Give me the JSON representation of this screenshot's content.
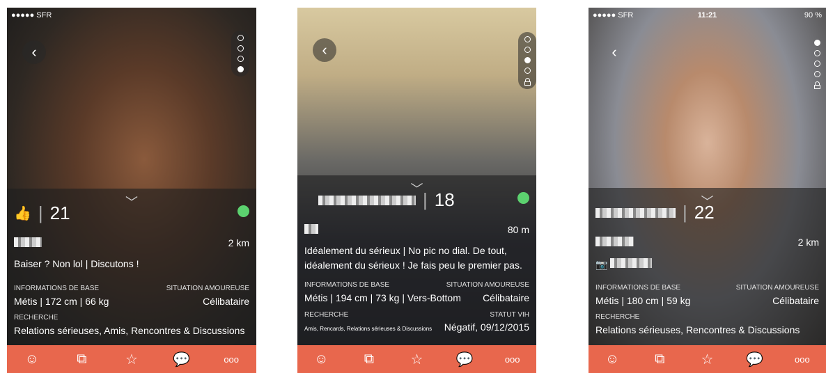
{
  "phone1": {
    "status": {
      "carrier": "●●●●● SFR"
    },
    "age": "21",
    "distance": "2 km",
    "about": "Baiser ? Non lol | Discutons !",
    "base_label": "INFORMATIONS DE BASE",
    "status_label": "SITUATION AMOUREUSE",
    "base_value": "Métis | 172 cm | 66 kg",
    "status_value": "Célibataire",
    "search_label": "RECHERCHE",
    "search_value": "Relations sérieuses, Amis, Rencontres & Discussions"
  },
  "phone2": {
    "age": "18",
    "distance": "80 m",
    "about": "Idéalement du sérieux  | No pic no dial. De tout, idéalement du sérieux ! Je fais peu le premier pas.",
    "base_label": "INFORMATIONS DE BASE",
    "status_label": "SITUATION AMOUREUSE",
    "base_value": "Métis | 194 cm | 73 kg | Vers-Bottom",
    "status_value": "Célibataire",
    "search_label": "RECHERCHE",
    "hiv_label": "STATUT VIH",
    "search_value": "Amis, Rencards, Relations sérieuses & Discussions",
    "hiv_value": "Négatif, 09/12/2015"
  },
  "phone3": {
    "status": {
      "carrier": "●●●●● SFR",
      "clock": "11:21",
      "battery": "90 %"
    },
    "age": "22",
    "distance": "2 km",
    "base_label": "INFORMATIONS DE BASE",
    "status_label": "SITUATION AMOUREUSE",
    "base_value": "Métis | 180 cm | 59 kg",
    "status_value": "Célibataire",
    "search_label": "RECHERCHE",
    "search_value": "Relations sérieuses, Rencontres & Discussions"
  },
  "tabs": {
    "emoji": "☺",
    "collection": "⧉",
    "star": "☆",
    "chat": "💬",
    "more": "ooo"
  },
  "colors": {
    "tabbar": "#e8674d",
    "online": "#5cd26f"
  }
}
